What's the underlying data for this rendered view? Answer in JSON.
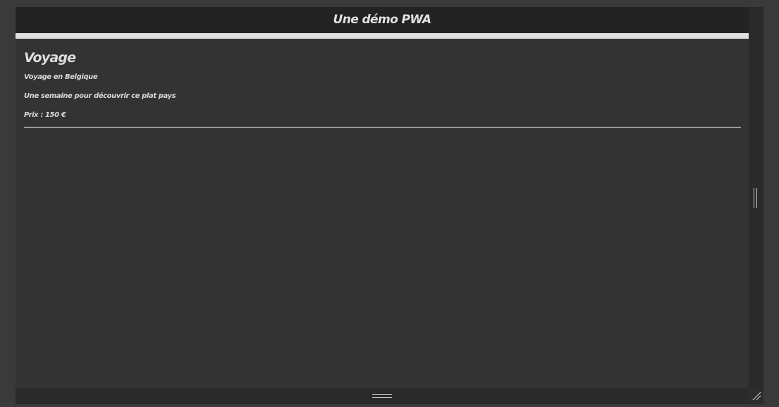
{
  "header": {
    "title": "Une démo PWA"
  },
  "main": {
    "section_title": "Voyage",
    "trip": {
      "name": "Voyage en Belgique",
      "description": "Une semaine pour découvrir ce plat pays",
      "price": "Prix : 150 €"
    }
  },
  "icons": {
    "vertical_resize": "vertical-resize-grip-icon",
    "horizontal_resize": "horizontal-resize-grip-icon",
    "corner_resize": "corner-resize-grip-icon"
  },
  "colors": {
    "page_background": "#333333",
    "header_background": "#232323",
    "header_bar": "#dedede",
    "text": "#dedede",
    "divider": "#9a9a9a"
  }
}
